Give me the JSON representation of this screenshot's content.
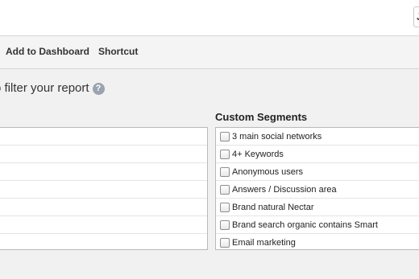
{
  "top_widget": {
    "text": "J"
  },
  "toolbar": {
    "add_label": "Add to Dashboard",
    "shortcut_label": "Shortcut"
  },
  "filter": {
    "heading": "o filter your report",
    "help": "?"
  },
  "custom_segments": {
    "title": "Custom Segments",
    "items": [
      {
        "label": "3 main social networks",
        "checked": false
      },
      {
        "label": "4+ Keywords",
        "checked": false
      },
      {
        "label": "Anonymous users",
        "checked": false
      },
      {
        "label": "Answers / Discussion area",
        "checked": false
      },
      {
        "label": "Brand natural Nectar",
        "checked": false
      },
      {
        "label": "Brand search organic contains Smart",
        "checked": false
      },
      {
        "label": "Email marketing",
        "checked": false
      }
    ]
  }
}
